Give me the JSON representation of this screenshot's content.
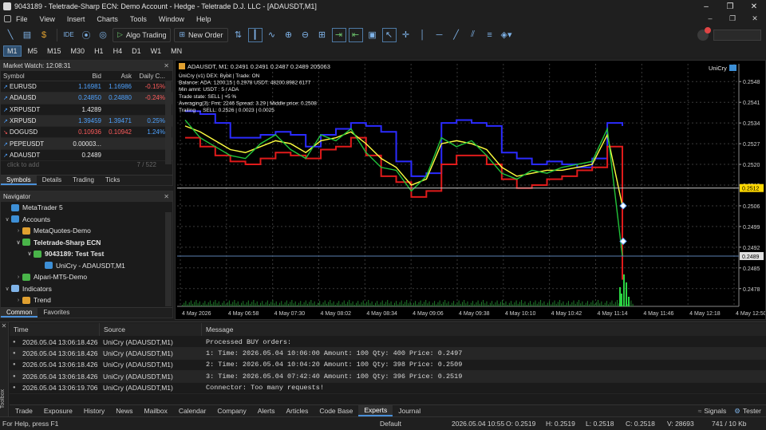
{
  "window": {
    "title": "9043189 - Teletrade-Sharp ECN: Demo Account - Hedge - Teletrade D.J. LLC - [ADAUSDT,M1]",
    "controls": [
      "–",
      "❐",
      "✕"
    ]
  },
  "menu": {
    "items": [
      "File",
      "View",
      "Insert",
      "Charts",
      "Tools",
      "Window",
      "Help"
    ],
    "right": [
      "–",
      "❐",
      "✕"
    ]
  },
  "toolbar": {
    "algo_trading": "Algo Trading",
    "new_order": "New Order",
    "ide": "IDE"
  },
  "timeframes": [
    "M1",
    "M5",
    "M15",
    "M30",
    "H1",
    "H4",
    "D1",
    "W1",
    "MN"
  ],
  "market_watch": {
    "title": "Market Watch: 12:08:31",
    "columns": [
      "Symbol",
      "Bid",
      "Ask",
      "Daily C..."
    ],
    "rows": [
      {
        "symbol": "EURUSD",
        "bid": "1.16981",
        "ask": "1.16986",
        "change": "-0.15%",
        "dir": "up"
      },
      {
        "symbol": "ADAUSD",
        "bid": "0.24850",
        "ask": "0.24880",
        "change": "-0.24%",
        "dir": "up"
      },
      {
        "symbol": "XRPUSDT",
        "bid": "1.4289",
        "ask": "",
        "change": "",
        "dir": "up"
      },
      {
        "symbol": "XRPUSD",
        "bid": "1.39459",
        "ask": "1.39471",
        "change": "0.25%",
        "dir": "up"
      },
      {
        "symbol": "DOGUSD",
        "bid": "0.10936",
        "ask": "0.10942",
        "change": "1.24%",
        "dir": "down"
      },
      {
        "symbol": "PEPEUSDT",
        "bid": "0.00003...",
        "ask": "",
        "change": "",
        "dir": "up"
      },
      {
        "symbol": "ADAUSDT",
        "bid": "0.2489",
        "ask": "",
        "change": "",
        "dir": "up"
      }
    ],
    "add_hint": "click to add",
    "count": "7 / 522",
    "tabs": [
      "Symbols",
      "Details",
      "Trading",
      "Ticks"
    ]
  },
  "navigator": {
    "title": "Navigator",
    "items": [
      {
        "label": "MetaTrader 5",
        "level": 0,
        "chevron": "",
        "bold": false,
        "color": "#3d8fd6"
      },
      {
        "label": "Accounts",
        "level": 0,
        "chevron": "∨",
        "bold": false,
        "color": "#3d8fd6"
      },
      {
        "label": "MetaQuotes-Demo",
        "level": 1,
        "chevron": "›",
        "bold": false,
        "color": "#e0a030"
      },
      {
        "label": "Teletrade-Sharp ECN",
        "level": 1,
        "chevron": "∨",
        "bold": true,
        "color": "#49b449"
      },
      {
        "label": "9043189: Test Test",
        "level": 2,
        "chevron": "∨",
        "bold": true,
        "color": "#49b449"
      },
      {
        "label": "UniCry - ADAUSDT,M1",
        "level": 3,
        "chevron": "",
        "bold": false,
        "color": "#3d8fd6"
      },
      {
        "label": "Alpari-MT5-Demo",
        "level": 1,
        "chevron": "›",
        "bold": false,
        "color": "#49b449"
      },
      {
        "label": "Indicators",
        "level": 0,
        "chevron": "∨",
        "bold": false,
        "color": "#7fb3e8"
      },
      {
        "label": "Trend",
        "level": 1,
        "chevron": "›",
        "bold": false,
        "color": "#e0a030"
      }
    ],
    "tabs": [
      "Common",
      "Favorites"
    ]
  },
  "chart": {
    "header": "ADAUSDT, M1:  0.2491 0.2491 0.2487 0.2489  205063",
    "ea_name": "UniCry",
    "overlay_lines": [
      "UniCry (v1) DEX: Bybit | Trade: ON",
      "Balance: ADA: 1200.15 | 0.2978 USDT: 48200.8982 6177",
      "Min amnt: USDT : 5 / ADA",
      "Trade state: SELL | +5 %",
      "Averaging(3): Fmt: 2246 Spread: 3.29 | Middle price: 0.2508",
      "Trailing ... SELL: 0.2526 | 0.0023 | 0.0025"
    ],
    "bid_label": "0.2512",
    "last_label": "0.2489",
    "colors": {
      "blue": "#2b2bff",
      "red": "#e01b1b",
      "yellow": "#ffff40",
      "green": "#22c43a",
      "grid": "#3a3a3a"
    }
  },
  "chart_data": {
    "type": "line",
    "title": "ADAUSDT, M1",
    "x_tick_labels": [
      "4 May 2026",
      "4 May 06:58",
      "4 May 07:30",
      "4 May 08:02",
      "4 May 08:34",
      "4 May 09:06",
      "4 May 09:38",
      "4 May 10:10",
      "4 May 10:42",
      "4 May 11:14",
      "4 May 11:46",
      "4 May 12:18",
      "4 May 12:50"
    ],
    "y_tick_labels": [
      "0.2548",
      "0.2541",
      "0.2534",
      "0.2527",
      "0.2520",
      "0.2513",
      "0.2506",
      "0.2499",
      "0.2492",
      "0.2485",
      "0.2478"
    ],
    "ylim": [
      0.2472,
      0.2554
    ],
    "grid": true,
    "current_price": 0.2489,
    "bid_line": 0.2512,
    "series": [
      {
        "name": "",
        "color": "#2b2bff",
        "values": [
          0.2538,
          0.2537,
          0.2534,
          0.2529,
          0.2529,
          0.253,
          0.2531,
          0.253,
          0.2526,
          0.253,
          0.2532,
          0.2534,
          0.2533,
          0.2531,
          0.2521,
          0.2516,
          0.2517,
          0.2534,
          0.2535,
          0.2534,
          0.2533,
          0.2524,
          0.2522,
          0.252,
          0.2521,
          0.252,
          0.2519,
          0.2522,
          0.2534,
          0.2533
        ]
      },
      {
        "name": "",
        "color": "#e01b1b",
        "values": [
          0.2529,
          0.2526,
          0.2523,
          0.2521,
          0.252,
          0.2522,
          0.2524,
          0.2523,
          0.2522,
          0.2525,
          0.2526,
          0.2529,
          0.2523,
          0.2516,
          0.2514,
          0.2509,
          0.2511,
          0.252,
          0.2523,
          0.2523,
          0.252,
          0.2515,
          0.2512,
          0.2513,
          0.2515,
          0.2516,
          0.2518,
          0.2519,
          0.2526,
          0.2481
        ]
      },
      {
        "name": "",
        "color": "#ffff40",
        "values": [
          0.2533,
          0.2531,
          0.2528,
          0.2525,
          0.2524,
          0.2526,
          0.2528,
          0.2527,
          0.2524,
          0.2528,
          0.2529,
          0.2531,
          0.2527,
          0.2522,
          0.2519,
          0.2513,
          0.2515,
          0.2527,
          0.2528,
          0.2527,
          0.2525,
          0.2519,
          0.2516,
          0.2517,
          0.2518,
          0.2518,
          0.2519,
          0.252,
          0.253,
          0.2506
        ]
      },
      {
        "name": "",
        "color": "#22c43a",
        "values": [
          0.2535,
          0.2529,
          0.2526,
          0.2523,
          0.2522,
          0.2527,
          0.253,
          0.2525,
          0.2522,
          0.253,
          0.2528,
          0.2532,
          0.2524,
          0.2519,
          0.2518,
          0.2511,
          0.2516,
          0.2529,
          0.2526,
          0.2528,
          0.2523,
          0.2517,
          0.2515,
          0.2518,
          0.2517,
          0.2519,
          0.252,
          0.2521,
          0.2532,
          0.2489
        ]
      }
    ]
  },
  "toolbox": {
    "side_label": "Toolbox",
    "columns": [
      "Time",
      "Source",
      "Message"
    ],
    "rows": [
      {
        "time": "2026.05.04 13:06:18.426",
        "source": "UniCry (ADAUSDT,M1)",
        "message": "Processed BUY orders:"
      },
      {
        "time": "2026.05.04 13:06:18.426",
        "source": "UniCry (ADAUSDT,M1)",
        "message": "1: Time: 2026.05.04 10:06:00 Amount: 100 Qty: 400 Price: 0.2497"
      },
      {
        "time": "2026.05.04 13:06:18.426",
        "source": "UniCry (ADAUSDT,M1)",
        "message": "2: Time: 2026.05.04 10:04:20 Amount: 100 Qty: 398 Price: 0.2509"
      },
      {
        "time": "2026.05.04 13:06:18.426",
        "source": "UniCry (ADAUSDT,M1)",
        "message": "3: Time: 2026.05.04 07:42:40 Amount: 100 Qty: 396 Price: 0.2519"
      },
      {
        "time": "2026.05.04 13:06:19.706",
        "source": "UniCry (ADAUSDT,M1)",
        "message": "Connector: Too many requests!"
      }
    ],
    "tabs": [
      "Trade",
      "Exposure",
      "History",
      "News",
      "Mailbox",
      "Calendar",
      "Company",
      "Alerts",
      "Articles",
      "Code Base",
      "Experts",
      "Journal"
    ],
    "active_tab": "Experts",
    "right": {
      "signals": "Signals",
      "tester": "Tester"
    }
  },
  "status": {
    "help": "For Help, press F1",
    "profile": "Default",
    "datetime": "2026.05.04 10:55",
    "open": "O: 0.2519",
    "high": "H: 0.2519",
    "low": "L: 0.2518",
    "close": "C: 0.2518",
    "volume": "V: 28693",
    "traffic": "741 / 10 Kb"
  }
}
